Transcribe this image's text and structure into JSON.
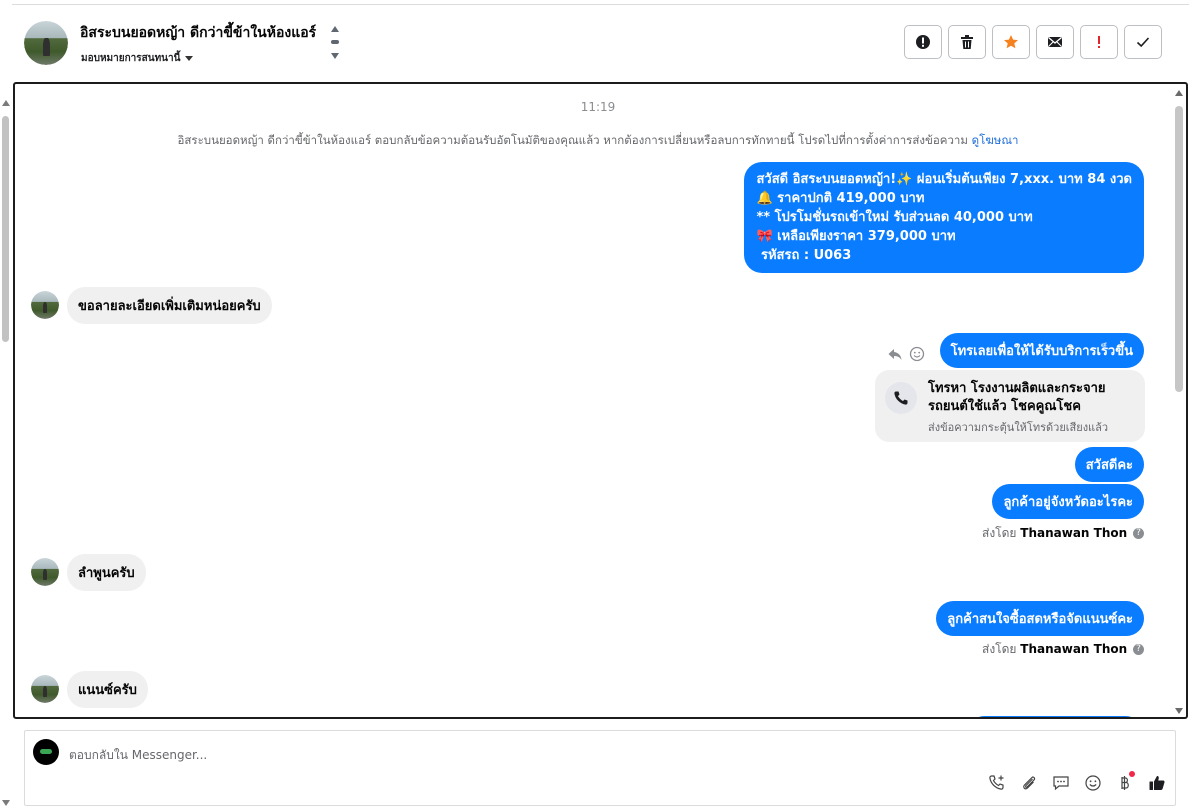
{
  "header": {
    "contact_name": "อิสระบนยอดหญ้า ดีกว่าขี้ข้าในห้องแอร์",
    "assign_label": "มอบหมายการสนทนานี้",
    "actions": [
      {
        "name": "spam-button",
        "icon": "alert-circle-icon"
      },
      {
        "name": "delete-button",
        "icon": "trash-icon"
      },
      {
        "name": "star-button",
        "icon": "star-icon"
      },
      {
        "name": "mark-unread-button",
        "icon": "envelope-icon"
      },
      {
        "name": "follow-up-button",
        "icon": "exclamation-icon"
      },
      {
        "name": "done-button",
        "icon": "check-icon"
      }
    ]
  },
  "colors": {
    "accent": "#0a7cff",
    "star": "#f5821f",
    "exclamation": "#e4252b",
    "incoming_bubble": "#f0f0f0"
  },
  "chat": {
    "timestamp": "11:19",
    "notice_text": "อิสระบนยอดหญ้า ดีกว่าขี้ข้าในห้องแอร์ ตอบกลับข้อความต้อนรับอัตโนมัติของคุณแล้ว หากต้องการเปลี่ยนหรือลบการทักทายนี้ โปรดไปที่การตั้งค่าการส่งข้อความ",
    "notice_link": "ดูโฆษณา",
    "welcome_lines": [
      "สวัสดี อิสระบนยอดหญ้า!✨  ผ่อนเริ่มต้นเพียง 7,xxx. บาท 84 งวด",
      "🔔 ราคาปกติ 419,000 บาท",
      "** โปรโมชั่นรถเข้าใหม่ รับส่วนลด 40,000 บาท",
      "🎀  เหลือเพียงราคา 379,000 บาท",
      " รหัสรถ : U063"
    ],
    "incoming_1": "ขอลายละเอียดเพิ่มเติมหน่อยครับ",
    "outgoing_call": "โทรเลยเพื่อให้ได้รับบริการเร็วขึ้น",
    "call_card_title": "โทรหา โรงงานผลิตและกระจายรถยนต์ใช้แล้ว โชคคูณโชค",
    "call_card_sub": "ส่งข้อความกระตุ้นให้โทรด้วยเสียงแล้ว",
    "outgoing_hello": "สวัสดีคะ",
    "outgoing_province": "ลูกค้าอยู่จังหวัดอะไรคะ",
    "sent_by_prefix": "ส่งโดย",
    "sent_by_name": "Thanawan Thon",
    "incoming_2": "ลำพูนครับ",
    "outgoing_interest": "ลูกค้าสนใจซื้อสดหรือจัดแนนซ์คะ",
    "incoming_3": "แนนซ์ครับ"
  },
  "composer": {
    "placeholder": "ตอบกลับใน Messenger...",
    "tools": [
      "phone-add-icon",
      "paperclip-icon",
      "saved-reply-icon",
      "emoji-icon",
      "baht-icon",
      "thumbs-up-icon"
    ]
  }
}
